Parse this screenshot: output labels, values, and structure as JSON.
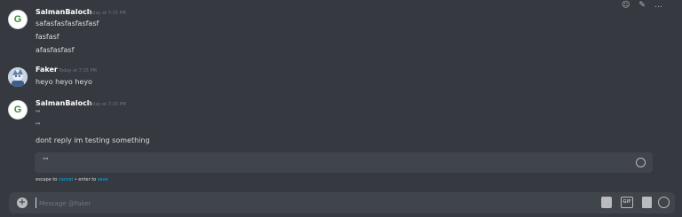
{
  "toolbar": {
    "add_reaction_icon": "add-reaction-icon",
    "edit_icon": "edit-icon",
    "more_icon": "more-icon",
    "more_label": "…"
  },
  "messages": [
    {
      "username": "SalmanBaloch",
      "timestamp": "Today at 7:15 PM",
      "avatar_letter": "G",
      "lines": [
        "safasfasfasfasfasf",
        "fasfasf",
        "afasfasfasf"
      ]
    },
    {
      "username": "Faker",
      "timestamp": "Today at 7:15 PM",
      "avatar_letter": "",
      "lines": [
        "heyo heyo heyo"
      ]
    },
    {
      "username": "SalmanBaloch",
      "timestamp": "Today at 7:15 PM",
      "avatar_letter": "G",
      "lines": [
        "\"\"",
        "\"\"",
        "dont reply im testing something"
      ]
    }
  ],
  "edit": {
    "value": "\"\"",
    "hint_escape": "escape to ",
    "cancel_label": "cancel",
    "hint_enter": " • enter to ",
    "save_label": "save"
  },
  "composer": {
    "placeholder": "Message @Faker",
    "plus_label": "+",
    "gif_label": "GIF"
  },
  "colors": {
    "background": "#36393f",
    "input_bg": "#40444b",
    "link": "#00b0f4",
    "timestamp": "#72767d"
  }
}
